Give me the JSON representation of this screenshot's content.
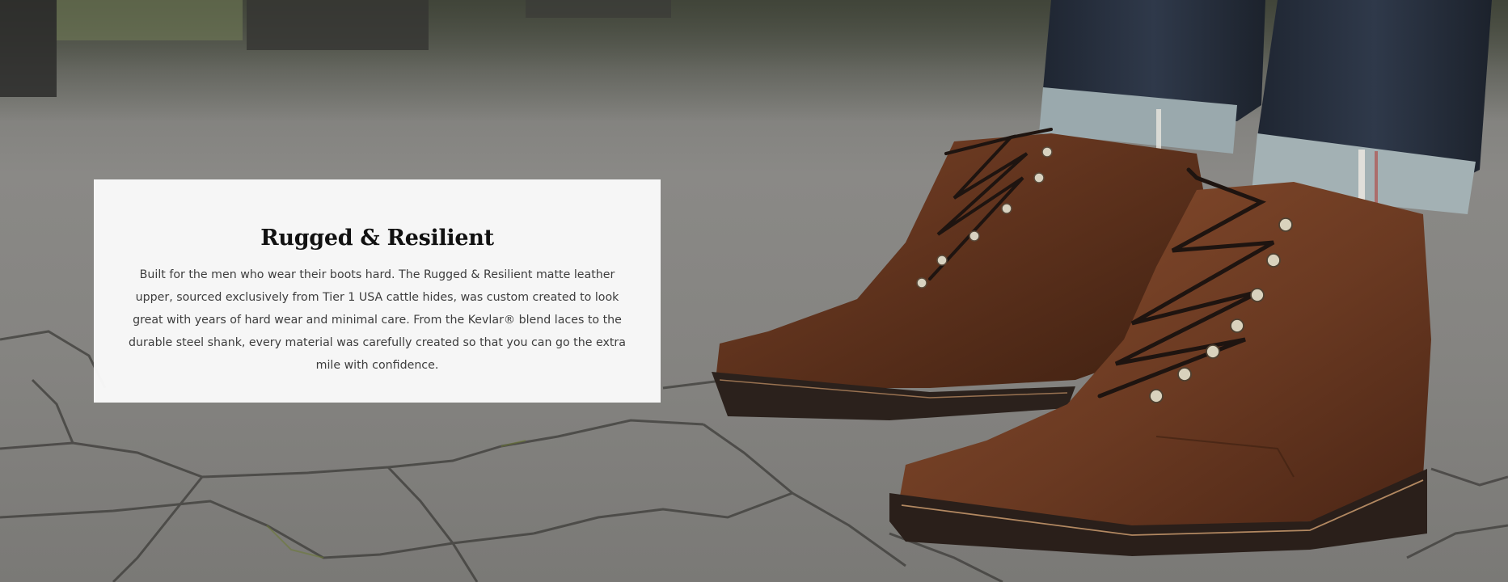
{
  "hero": {
    "image_alt": "Brown leather lace-up boots on cobblestone pavement",
    "colors": {
      "pavement": "#858481",
      "leather": "#6b3a22",
      "denim": "#2b3442",
      "card_background": "#fafafa",
      "title_text": "#111111",
      "body_text": "#3d3d3d"
    }
  },
  "card": {
    "title": "Rugged & Resilient",
    "body": "Built for the men who wear their boots hard. The Rugged & Resilient matte leather upper, sourced exclusively from Tier 1 USA cattle hides, was custom created to look great with years of hard wear and minimal care. From the Kevlar® blend laces to the durable steel shank, every material was carefully created so that you can go the extra mile with confidence."
  }
}
